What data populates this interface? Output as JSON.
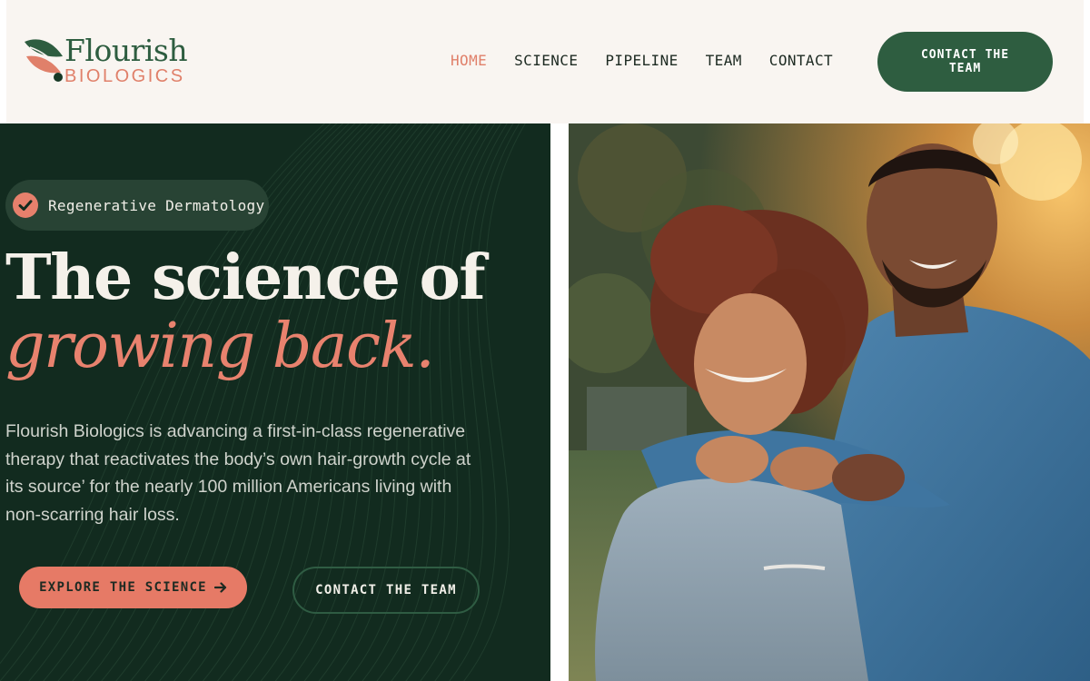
{
  "brand": {
    "name": "Flourish",
    "subname": "BIOLOGICS"
  },
  "nav": {
    "items": [
      "HOME",
      "SCIENCE",
      "PIPELINE",
      "TEAM",
      "CONTACT"
    ],
    "active": "HOME"
  },
  "header": {
    "cta_label": "CONTACT THE TEAM"
  },
  "hero": {
    "badge_icon": "check-circle-icon",
    "badge_label": "Regenerative Dermatology",
    "headline_line1": "The science of",
    "headline_line2": "growing back.",
    "body": "Flourish Biologics is advancing a first-in-class regenerative therapy that reactivates the body’s own hair-growth cycle at its source’ for the nearly 100 million Americans living with non-scarring hair loss.",
    "primary_cta": "EXPLORE THE SCIENCE",
    "primary_cta_icon": "arrow-right-icon",
    "secondary_cta": "CONTACT THE TEAM"
  },
  "colors": {
    "brand_green": "#2e5d40",
    "dark_green": "#122b1f",
    "coral": "#e67a66",
    "cream": "#f9f5f1"
  }
}
